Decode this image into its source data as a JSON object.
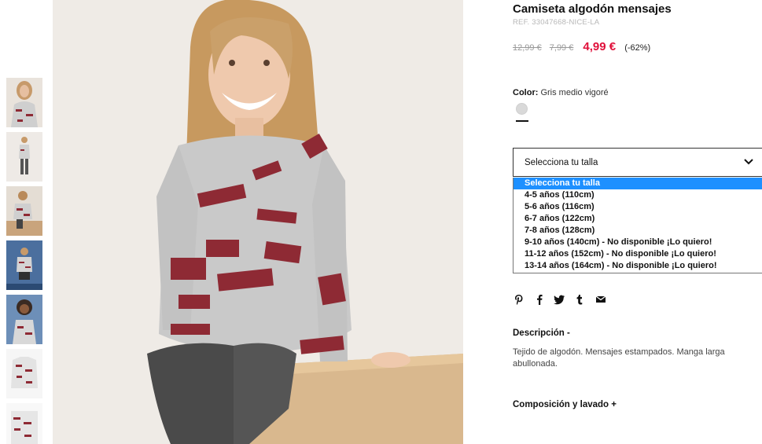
{
  "product": {
    "title": "Camiseta algodón mensajes",
    "ref": "REF. 33047668-NICE-LA",
    "old_price_1": "12,99 €",
    "old_price_2": "7,99 €",
    "current_price": "4,99 €",
    "discount": "(-62%)"
  },
  "color": {
    "label": "Color:",
    "value": "Gris medio vigoré",
    "swatch_hex": "#d9d9d9"
  },
  "size_select": {
    "selected": "Selecciona tu talla",
    "options": [
      "Selecciona tu talla",
      "4-5 años (110cm)",
      "5-6 años (116cm)",
      "6-7 años (122cm)",
      "7-8 años (128cm)",
      "9-10 años (140cm) - No disponible ¡Lo quiero!",
      "11-12 años (152cm) - No disponible ¡Lo quiero!",
      "13-14 años (164cm) - No disponible ¡Lo quiero!"
    ]
  },
  "share": {
    "icons": [
      "pinterest-icon",
      "facebook-icon",
      "twitter-icon",
      "tumblr-icon",
      "email-icon"
    ]
  },
  "description": {
    "title": "Descripción -",
    "text": "Tejido de algodón. Mensajes estampados. Manga larga abullonada."
  },
  "composition": {
    "title": "Composición y lavado +"
  },
  "colors": {
    "accent_price": "#e0103a",
    "selected_option_bg": "#1e90ff",
    "print_red": "#8e2a34",
    "sweater_grey": "#c9c9c9"
  }
}
